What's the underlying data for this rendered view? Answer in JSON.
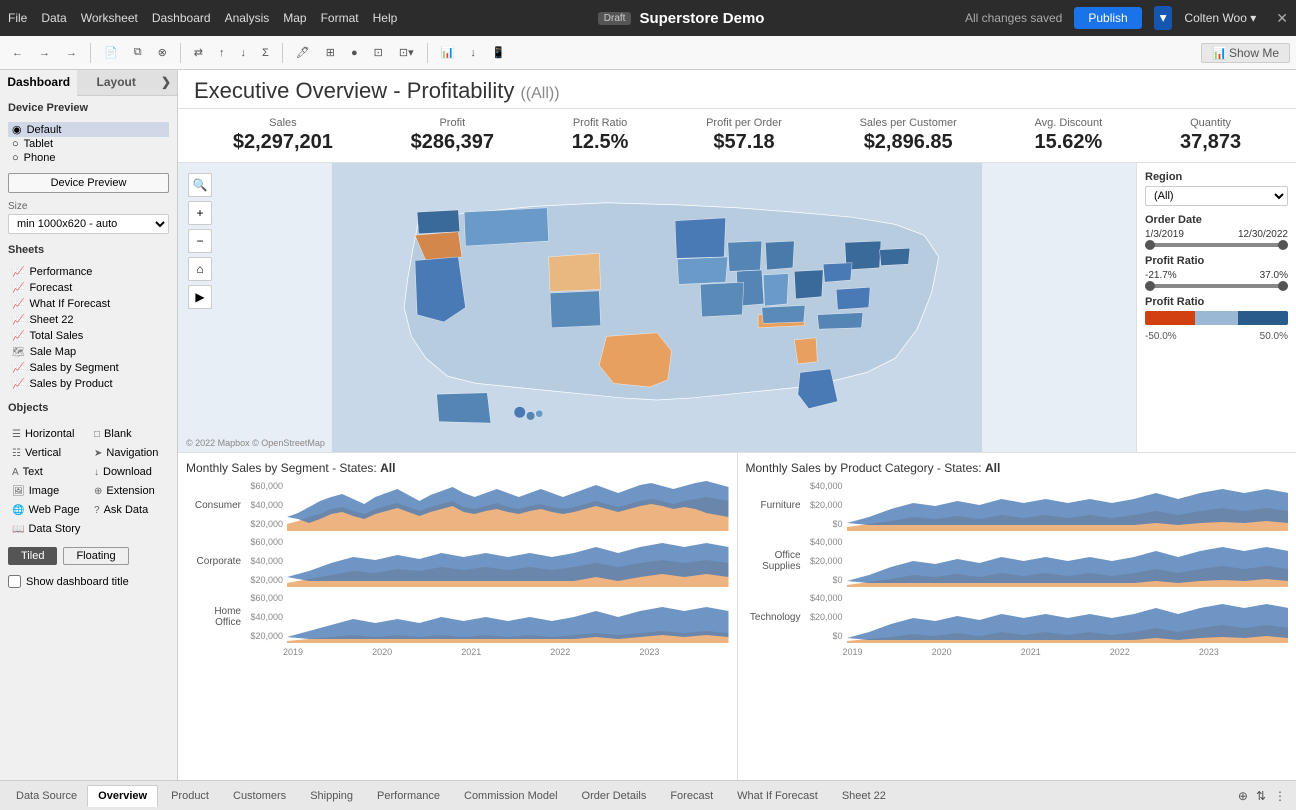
{
  "topbar": {
    "draft_badge": "Draft",
    "title": "Superstore Demo",
    "saved_text": "All changes saved",
    "publish_label": "Publish",
    "user_label": "Colten Woo ▾",
    "menu": [
      "File",
      "Data",
      "Worksheet",
      "Dashboard",
      "Analysis",
      "Map",
      "Format",
      "Help"
    ]
  },
  "sidebar": {
    "dashboard_tab": "Dashboard",
    "layout_tab": "Layout",
    "chevron": "❯",
    "device_preview_label": "Device Preview",
    "device_options": [
      "Default",
      "Tablet",
      "Phone"
    ],
    "size_label": "Size",
    "size_value": "min 1000x620 - auto",
    "sheets_label": "Sheets",
    "sheets": [
      "Performance",
      "Forecast",
      "What If Forecast",
      "Sheet 22",
      "Total Sales",
      "Sale Map",
      "Sales by Segment",
      "Sales by Product"
    ],
    "objects_label": "Objects",
    "objects": [
      {
        "label": "Horizontal",
        "icon": "☰"
      },
      {
        "label": "Blank",
        "icon": "□"
      },
      {
        "label": "Vertical",
        "icon": "☷"
      },
      {
        "label": "Navigation",
        "icon": "➤"
      },
      {
        "label": "Text",
        "icon": "A"
      },
      {
        "label": "Download",
        "icon": "↓"
      },
      {
        "label": "Image",
        "icon": "🖼"
      },
      {
        "label": "Extension",
        "icon": "⊕"
      },
      {
        "label": "Web Page",
        "icon": "🌐"
      },
      {
        "label": "Ask Data",
        "icon": "?"
      },
      {
        "label": "Data Story",
        "icon": "📖"
      }
    ],
    "tiled_label": "Tiled",
    "floating_label": "Floating",
    "show_title_label": "Show dashboard title"
  },
  "dashboard": {
    "title": "Executive Overview - Profitability",
    "filter_all": "(All)",
    "kpis": [
      {
        "label": "Sales",
        "value": "$2,297,201"
      },
      {
        "label": "Profit",
        "value": "$286,397"
      },
      {
        "label": "Profit Ratio",
        "value": "12.5%"
      },
      {
        "label": "Profit per Order",
        "value": "$57.18"
      },
      {
        "label": "Sales per Customer",
        "value": "$2,896.85"
      },
      {
        "label": "Avg. Discount",
        "value": "15.62%"
      },
      {
        "label": "Quantity",
        "value": "37,873"
      }
    ],
    "filters": {
      "region_label": "Region",
      "region_value": "(All)",
      "order_date_label": "Order Date",
      "date_start": "1/3/2019",
      "date_end": "12/30/2022",
      "profit_ratio_label": "Profit Ratio",
      "profit_ratio_min": "-21.7%",
      "profit_ratio_max": "37.0%",
      "profit_ratio_bar_label": "Profit Ratio",
      "profit_ratio_bar_min": "-50.0%",
      "profit_ratio_bar_max": "50.0%"
    },
    "map_copyright": "© 2022 Mapbox  © OpenStreetMap",
    "monthly_sales_segment_title": "Monthly Sales by Segment - States:",
    "monthly_sales_segment_filter": "All",
    "monthly_sales_product_title": "Monthly Sales by Product Category - States:",
    "monthly_sales_product_filter": "All",
    "segment_rows": [
      {
        "label": "Consumer",
        "y_labels": [
          "$60,000",
          "$40,000",
          "$20,000"
        ]
      },
      {
        "label": "Corporate",
        "y_labels": [
          "$60,000",
          "$40,000",
          "$20,000"
        ]
      },
      {
        "label": "Home Office",
        "y_labels": [
          "$60,000",
          "$40,000",
          "$20,000"
        ]
      }
    ],
    "product_rows": [
      {
        "label": "Furniture",
        "y_labels": [
          "$40,000",
          "$20,000",
          "$0"
        ]
      },
      {
        "label": "Office\nSupplies",
        "y_labels": [
          "$40,000",
          "$20,000",
          "$0"
        ]
      },
      {
        "label": "Technology",
        "y_labels": [
          "$40,000",
          "$20,000",
          "$0"
        ]
      }
    ],
    "x_axis_years": [
      "2019",
      "2020",
      "2021",
      "2022",
      "2023"
    ]
  },
  "tabbar": {
    "source_label": "Data Source",
    "tabs": [
      "Overview",
      "Product",
      "Customers",
      "Shipping",
      "Performance",
      "Commission Model",
      "Order Details",
      "Forecast",
      "What If Forecast",
      "Sheet 22"
    ],
    "active_tab": "Overview"
  }
}
